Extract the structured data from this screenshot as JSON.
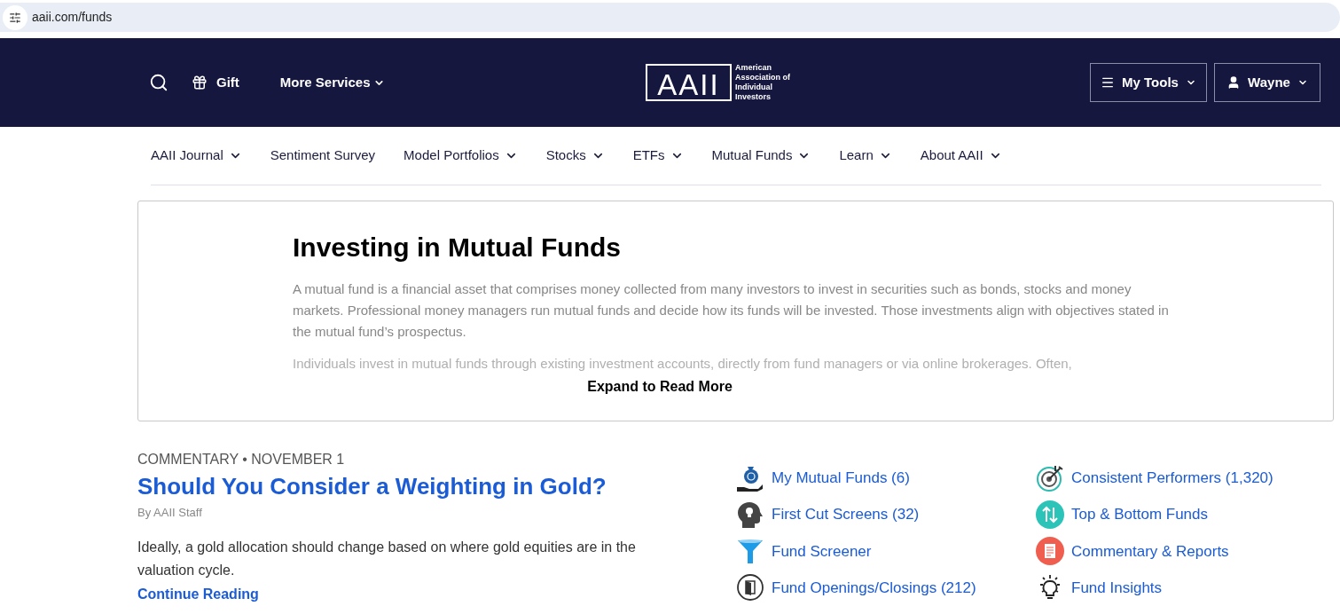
{
  "browser": {
    "url": "aaii.com/funds"
  },
  "header": {
    "gift": "Gift",
    "more_services": "More Services",
    "logo_mark": "AAII",
    "logo_text": [
      "American",
      "Association of",
      "Individual",
      "Investors"
    ],
    "my_tools": "My Tools",
    "user": "Wayne"
  },
  "nav": [
    {
      "label": "AAII Journal",
      "dropdown": true
    },
    {
      "label": "Sentiment Survey",
      "dropdown": false
    },
    {
      "label": "Model Portfolios",
      "dropdown": true
    },
    {
      "label": "Stocks",
      "dropdown": true
    },
    {
      "label": "ETFs",
      "dropdown": true
    },
    {
      "label": "Mutual Funds",
      "dropdown": true
    },
    {
      "label": "Learn",
      "dropdown": true
    },
    {
      "label": "About AAII",
      "dropdown": true
    }
  ],
  "intro": {
    "title": "Investing in Mutual Funds",
    "paragraphs": [
      "A mutual fund is a financial asset that comprises money collected from many investors to invest in securities such as bonds, stocks and money markets. Professional money managers run mutual funds and decide how its funds will be invested. Those investments align with objectives stated in the mutual fund’s prospectus.",
      "Individuals invest in mutual funds through existing investment accounts, directly from fund managers or via online brokerages. Often,"
    ],
    "expand": "Expand to Read More"
  },
  "article": {
    "kicker": "COMMENTARY • NOVEMBER 1",
    "title": "Should You Consider a Weighting in Gold?",
    "byline": "By AAII Staff",
    "summary": "Ideally, a gold allocation should change based on where gold equities are in the valuation cycle.",
    "link": "Continue Reading"
  },
  "links": [
    {
      "kind": "moneybag",
      "label": "My Mutual Funds (6)"
    },
    {
      "kind": "target",
      "label": "Consistent Performers (1,320)"
    },
    {
      "kind": "head",
      "label": "First Cut Screens (32)"
    },
    {
      "kind": "updown",
      "label": "Top & Bottom Funds"
    },
    {
      "kind": "funnel",
      "label": "Fund Screener"
    },
    {
      "kind": "report",
      "label": "Commentary & Reports"
    },
    {
      "kind": "door",
      "label": "Fund Openings/Closings (212)"
    },
    {
      "kind": "bulb",
      "label": "Fund Insights"
    }
  ]
}
